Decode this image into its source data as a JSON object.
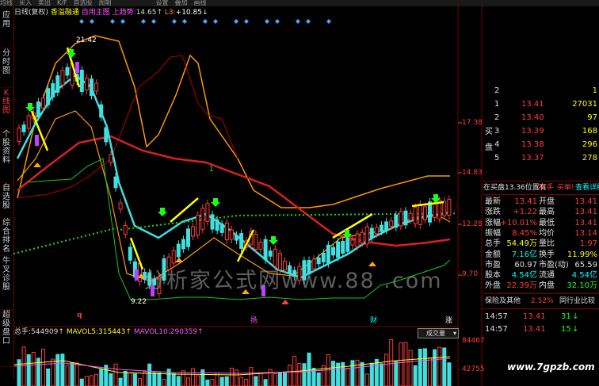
{
  "menu": [
    "均线",
    "买入",
    "卖出",
    "K/F",
    "自选股",
    "周期",
    "",
    "",
    "",
    "",
    "",
    "",
    "设置",
    "叠加",
    "画线",
    "",
    "",
    "",
    "",
    "",
    "",
    ""
  ],
  "left_tabs": [
    {
      "label": "应用",
      "active": false
    },
    {
      "label": "分时图",
      "active": false
    },
    {
      "label": "K线图",
      "active": true
    },
    {
      "label": "个股资料",
      "active": false
    },
    {
      "label": "自选股",
      "active": false
    },
    {
      "label": "综合排名",
      "active": false
    },
    {
      "label": "牛叉诊股",
      "active": false
    },
    {
      "label": "超级盘口",
      "active": false
    }
  ],
  "indicator_title": {
    "period": "日线(复权)",
    "name": "香溢融通",
    "formula": "自用主图 上趋势:",
    "trend_value": "14.65",
    "up_arrow": "↑",
    "l3_label": "L3:",
    "l3_value": "+10.85",
    "down_arrow": "↓"
  },
  "price_axis": [
    "17.38",
    "14.83",
    "12.28",
    "9.70"
  ],
  "chart_marks": {
    "high_label": "21.42",
    "low_label": "9.22",
    "sell_marker": "1",
    "bottom_marks": [
      "q",
      "扬",
      "财",
      "涨"
    ]
  },
  "watermark": "分析家公式网www.88   .com",
  "volume_header": {
    "total_label": "总手:",
    "total_value": "544909",
    "total_arrow": "↑",
    "mavol5_label": "MAVOL5:",
    "mavol5_value": "315443",
    "mavol5_arrow": "↑",
    "mavol10_label": "MAVOL10:",
    "mavol10_value": "290359",
    "mavol10_arrow": "↑",
    "dropdown": "成交量"
  },
  "volume_axis": [
    "84467",
    "42755"
  ],
  "site": "www.7gpzb.com",
  "order_book": {
    "side_label_top": "买",
    "side_label_bottom": "盘",
    "rows": [
      {
        "level": "2",
        "price": "",
        "vol": "1"
      },
      {
        "level": "1",
        "price": "13.41",
        "vol": "27031"
      },
      {
        "level": "2",
        "price": "13.40",
        "vol": "97"
      },
      {
        "level": "3",
        "price": "13.39",
        "vol": "168"
      },
      {
        "level": "4",
        "price": "13.38",
        "vol": "296"
      },
      {
        "level": "5",
        "price": "13.37",
        "vol": "278"
      }
    ]
  },
  "buy_strip": {
    "text": "在买盘13.36位置有",
    "qty": "2K手",
    "action": "买单!",
    "link": "查看详细"
  },
  "stats": [
    {
      "l1": "最新",
      "v1": "13.41",
      "l2": "开盘",
      "v2": "13.41",
      "c1": "red",
      "c2": "red"
    },
    {
      "l1": "涨跌",
      "v1": "+1.22",
      "l2": "最高",
      "v2": "13.41",
      "c1": "red",
      "c2": "red"
    },
    {
      "l1": "涨幅",
      "v1": "+10.01%",
      "l2": "最低",
      "v2": "13.41",
      "c1": "red",
      "c2": "red"
    },
    {
      "l1": "振幅",
      "v1": "8.45%",
      "l2": "均价",
      "v2": "13.14",
      "c1": "red",
      "c2": "red"
    },
    {
      "l1": "总手",
      "v1": "54.49万",
      "l2": "量比",
      "v2": "1.97",
      "c1": "yel",
      "c2": "red"
    },
    {
      "l1": "金额",
      "v1": "7.16亿",
      "l2": "换手",
      "v2": "11.99%",
      "c1": "cyn",
      "c2": "yel"
    },
    {
      "l1": "市盈",
      "v1": "60.97",
      "l2": "市盈(动)",
      "v2": "65.59",
      "c1": "wht",
      "c2": "wht"
    },
    {
      "l1": "股本",
      "v1": "4.54亿",
      "l2": "流通",
      "v2": "4.54亿",
      "c1": "cyn",
      "c2": "cyn"
    },
    {
      "l1": "外盘",
      "v1": "22.39万",
      "l2": "内盘",
      "v2": "32.10万",
      "c1": "red",
      "c2": "grn"
    }
  ],
  "bottom_info": {
    "label": "保险及其他",
    "value": "2.52%",
    "link": "同行业比较"
  },
  "ticks": [
    {
      "time": "14:57",
      "price": "13.41",
      "vol": "31",
      "arrow": "↓"
    },
    {
      "time": "14:57",
      "price": "13.41",
      "vol": "15",
      "arrow": "↓"
    }
  ],
  "colors": {
    "up": "#ff3b3b",
    "down": "#18ff18",
    "accent": "#ffff00",
    "frame": "#7a0000"
  }
}
